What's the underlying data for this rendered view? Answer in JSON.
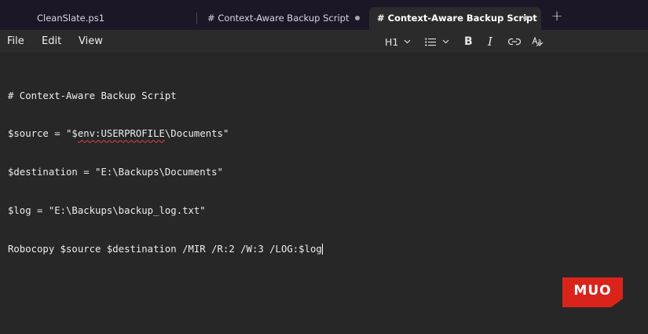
{
  "tabs": [
    {
      "label": "CleanSlate.ps1",
      "active": false,
      "unsaved": false
    },
    {
      "label": "# Context-Aware Backup Script",
      "active": false,
      "unsaved": true
    },
    {
      "label": "# Context-Aware Backup Script",
      "active": true,
      "unsaved": true
    }
  ],
  "new_tab_label": "+",
  "menu": {
    "file": "File",
    "edit": "Edit",
    "view": "View"
  },
  "toolbar": {
    "heading_label": "H1",
    "bold_label": "B",
    "italic_label": "I",
    "icons": [
      "chevron-down-icon",
      "bullet-list-icon",
      "link-icon",
      "spellcheck-icon"
    ]
  },
  "editor": {
    "lines": [
      {
        "text": "# Context-Aware Backup Script"
      },
      {
        "pre": "$source = \"$",
        "flagged": "env:USERPROFILE",
        "post": "\\Documents\""
      },
      {
        "text": "$destination = \"E:\\Backups\\Documents\""
      },
      {
        "text": "$log = \"E:\\Backups\\backup_log.txt\""
      },
      {
        "text": "Robocopy $source $destination /MIR /R:2 /W:3 /LOG:$log"
      }
    ]
  },
  "watermark": {
    "text": "MUO",
    "color": "#d9241b"
  },
  "colors": {
    "tabbar": "#1b1726",
    "toolbar": "#2b2b2b",
    "editor_bg": "#272727",
    "spell_error": "#e0433a"
  }
}
